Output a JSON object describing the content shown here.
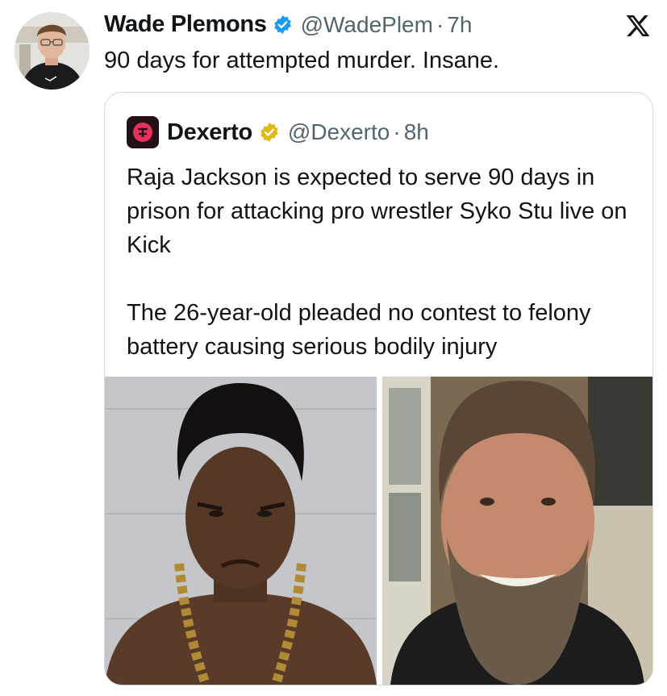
{
  "tweet": {
    "author_name": "Wade Plemons",
    "handle": "@WadePlem",
    "separator": "·",
    "time": "7h",
    "text": "90 days for attempted murder. Insane."
  },
  "platform_icon": "x-logo-icon",
  "quoted_tweet": {
    "author_name": "Dexerto",
    "handle": "@Dexerto",
    "separator": "·",
    "time": "8h",
    "paragraphs": [
      "Raja Jackson is expected to serve 90 days in prison for attacking pro wrestler Syko Stu live on Kick",
      "The 26-year-old pleaded no contest to felony battery causing serious bodily injury"
    ]
  },
  "colors": {
    "verified_blue": "#1d9bf0",
    "verified_gold": "#e2b719",
    "text_primary": "#0f1419",
    "text_secondary": "#536471",
    "border": "#cfd9de"
  }
}
